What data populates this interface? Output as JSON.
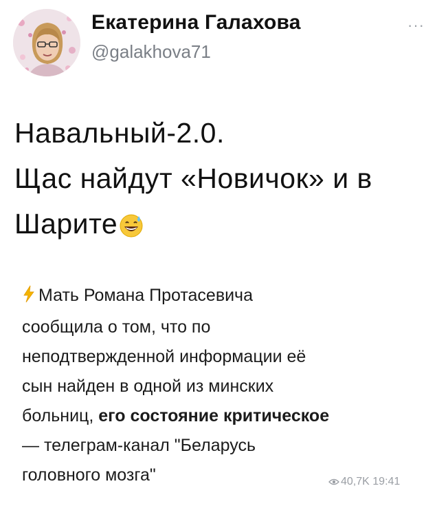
{
  "author": {
    "display_name": "Екатерина Галахова",
    "handle": "@galakhova71"
  },
  "actions": {
    "more_label": "···"
  },
  "tweet": {
    "lines": [
      "Навальный-2.0.",
      "Щас найдут «Новичок» и в",
      "Шарите"
    ],
    "emoji_name": "grinning-face-with-sweat-icon"
  },
  "quote": {
    "icon_name": "lightning-icon",
    "line1": "Мать Романа Протасевича",
    "line2": "сообщила о том, что по",
    "line3": "неподтвержденной информации её",
    "line4": "сын найден в одной из минских",
    "line5_pre": "больниц, ",
    "line5_bold": "его состояние критическое",
    "line6": "— телеграм-канал \"Беларусь",
    "line7": "головного мозга\""
  },
  "meta": {
    "views": "40,7K",
    "time": "19:41",
    "icon_name": "eye-icon"
  },
  "colors": {
    "text": "#111111",
    "handle": "#7a7f86",
    "meta": "#9a9ea4",
    "lightning": "#f4b400"
  }
}
